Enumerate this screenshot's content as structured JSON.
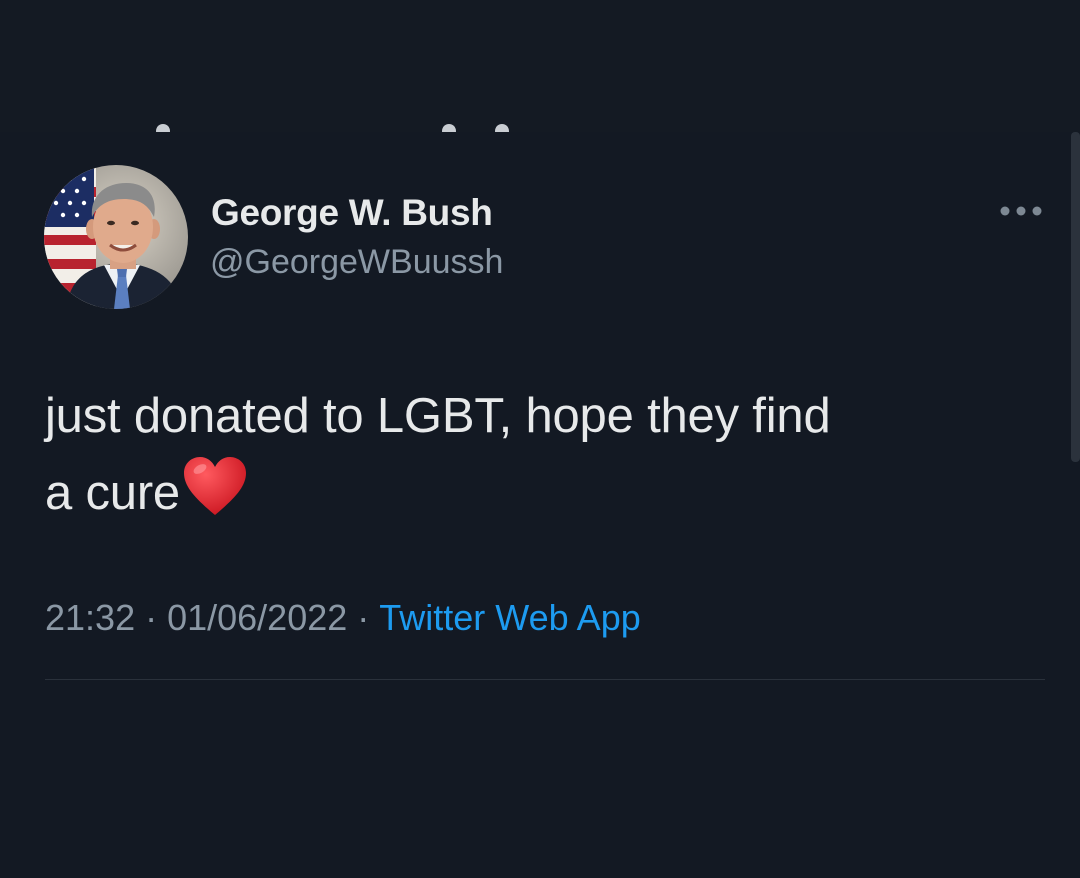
{
  "tweet": {
    "author": {
      "display_name": "George W. Bush",
      "handle": "@GeorgeWBuussh",
      "avatar_icon": "profile-photo"
    },
    "text_line_1": "just donated to LGBT, hope they find",
    "text_line_2": "a cure",
    "emoji": "red-heart",
    "time": "21:32",
    "date": "01/06/2022",
    "separator": "·",
    "source": "Twitter Web App",
    "more_icon": "more-dots-icon"
  },
  "colors": {
    "background": "#131923",
    "text_primary": "#e7e9ea",
    "text_secondary": "#8b98a5",
    "link": "#1d9bf0",
    "heart": "#e0202b"
  }
}
